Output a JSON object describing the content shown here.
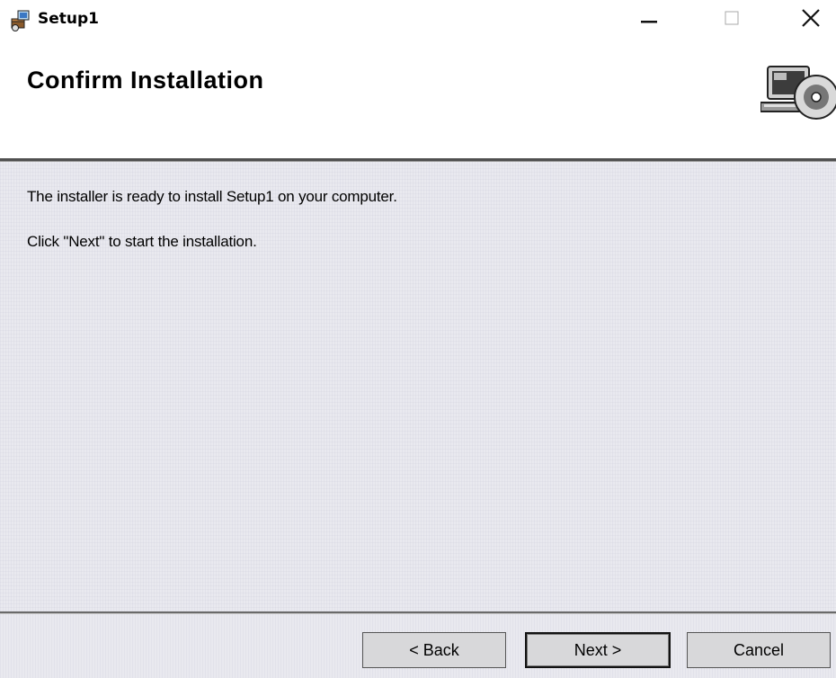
{
  "window": {
    "title": "Setup1",
    "controls": {
      "minimize_icon": "minimize-icon",
      "maximize_icon": "maximize-icon",
      "close_icon": "close-icon"
    }
  },
  "header": {
    "title": "Confirm Installation",
    "graphic_icon": "computer-cd-icon"
  },
  "content": {
    "line1": "The installer is ready to install Setup1 on your computer.",
    "line2": "Click \"Next\" to start the installation."
  },
  "buttons": {
    "back": "< Back",
    "next": "Next >",
    "cancel": "Cancel"
  },
  "colors": {
    "background": "#ffffff",
    "content_bg": "#e9e9ef",
    "button_bg": "#d8d8da"
  }
}
